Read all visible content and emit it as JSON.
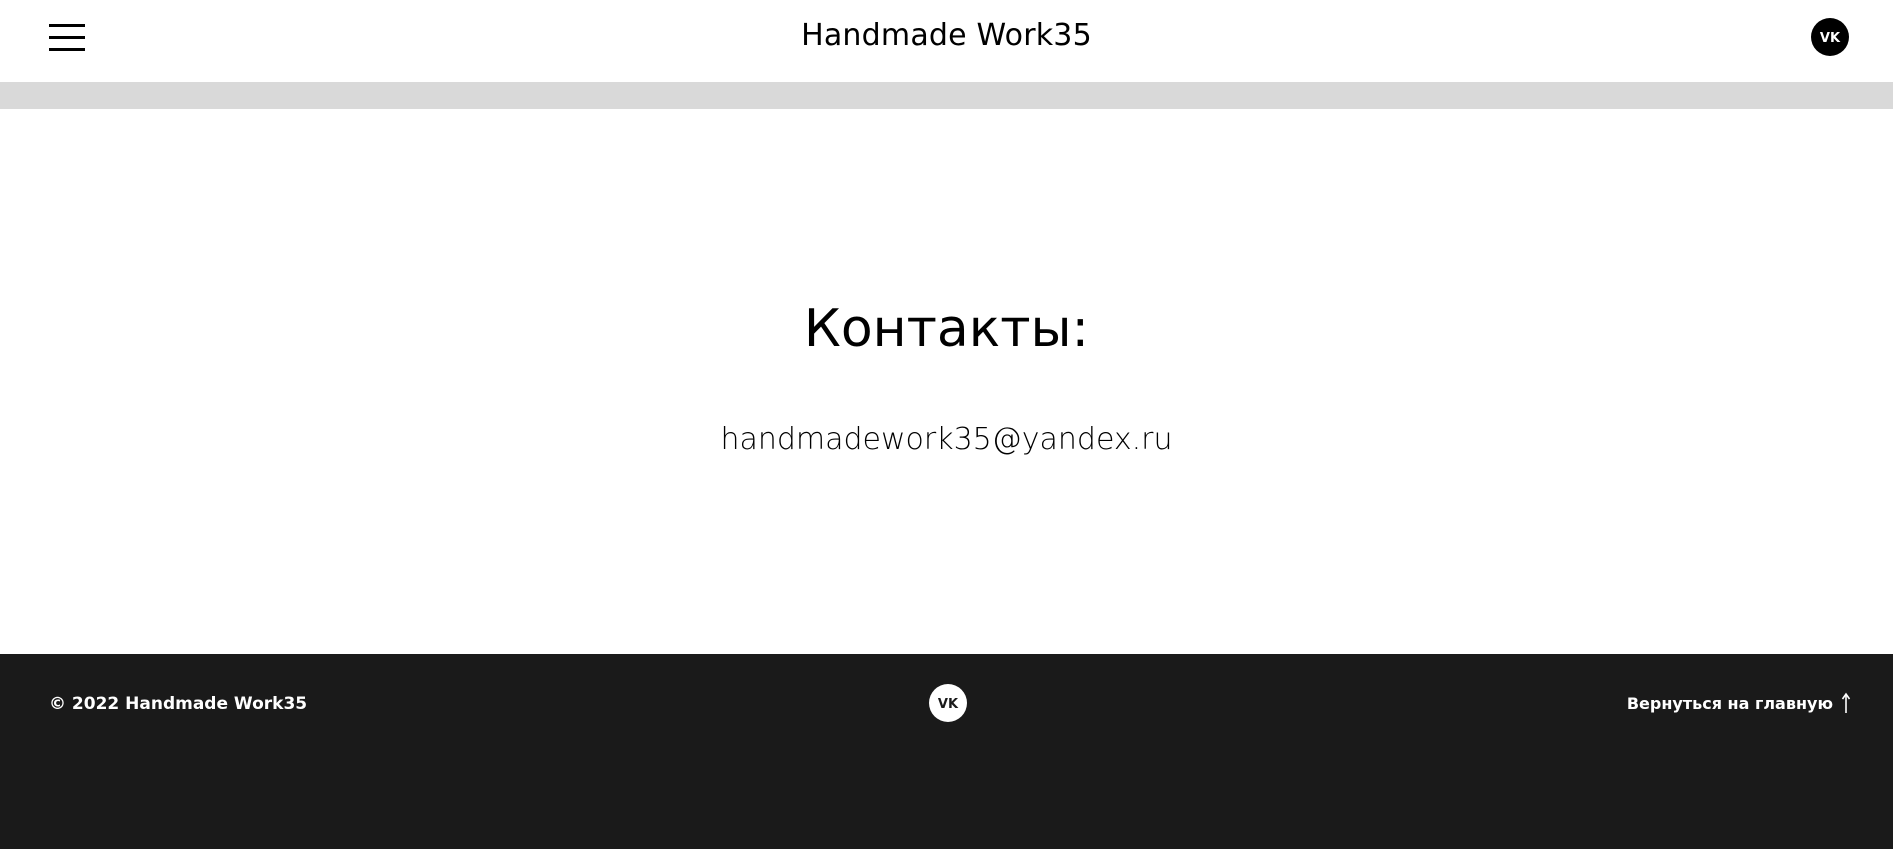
{
  "header": {
    "title": "Handmade Work35",
    "menu_icon": "hamburger-menu-icon",
    "vk_icon": "vk-icon"
  },
  "contacts": {
    "title": "Контакты:",
    "email": "handmadework35@yandex.ru"
  },
  "footer": {
    "copyright": "© 2022 Handmade Work35",
    "vk_icon": "vk-icon",
    "back_home_label": "Вернуться на главную",
    "back_home_icon": "arrow-up-icon"
  },
  "colors": {
    "header_bg": "#ffffff",
    "band_bg": "#d9d9d9",
    "footer_bg": "#1a1a1a",
    "text_dark": "#000000",
    "text_light": "#ffffff"
  }
}
